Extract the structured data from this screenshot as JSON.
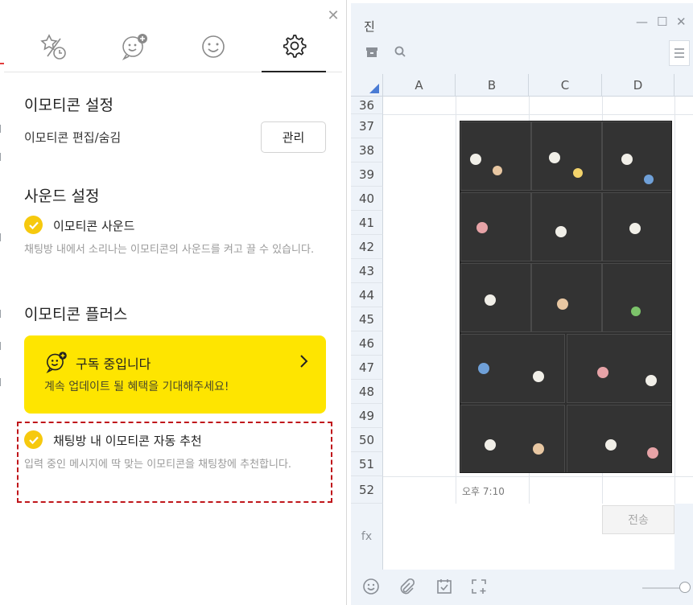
{
  "panel": {
    "tabs": [
      {
        "name": "recent-stickers",
        "icon": "star-clock-icon"
      },
      {
        "name": "add-emoticon",
        "icon": "add-emoticon-icon"
      },
      {
        "name": "emoticon",
        "icon": "smiley-icon"
      },
      {
        "name": "settings",
        "icon": "gear-icon",
        "active": true
      }
    ],
    "emoticon_settings": {
      "title": "이모티콘 설정",
      "edit_label": "이모티콘 편집/숨김",
      "manage_button": "관리"
    },
    "sound_settings": {
      "title": "사운드 설정",
      "option_label": "이모티콘 사운드",
      "checked": true,
      "description": "채팅방 내에서 소리나는 이모티콘의 사운드를 켜고 끌 수 있습니다."
    },
    "plus": {
      "title": "이모티콘 플러스",
      "card_title": "구독 중입니다",
      "card_sub": "계속 업데이트 될 혜택을 기대해주세요!"
    },
    "auto_recommend": {
      "label": "채팅방 내 이모티콘 자동 추천",
      "checked": true,
      "description": "입력 중인 메시지에 딱 맞는 이모티콘을 채팅창에 추천합니다."
    },
    "colors": {
      "accent": "#f6c90e",
      "plus_card": "#fee500",
      "highlight": "#c0161b"
    }
  },
  "chat_window": {
    "title": "진",
    "columns": [
      "A",
      "B",
      "C",
      "D"
    ],
    "rows": [
      "36",
      "37",
      "38",
      "39",
      "40",
      "41",
      "42",
      "43",
      "44",
      "45",
      "46",
      "47",
      "48",
      "49",
      "50",
      "51",
      "52"
    ],
    "timestamp": "오후 7:10",
    "fx_label": "fx",
    "send_button": "전송",
    "bottom_icons": [
      "emoji-icon",
      "paperclip-icon",
      "calendar-check-icon",
      "capture-icon"
    ]
  }
}
